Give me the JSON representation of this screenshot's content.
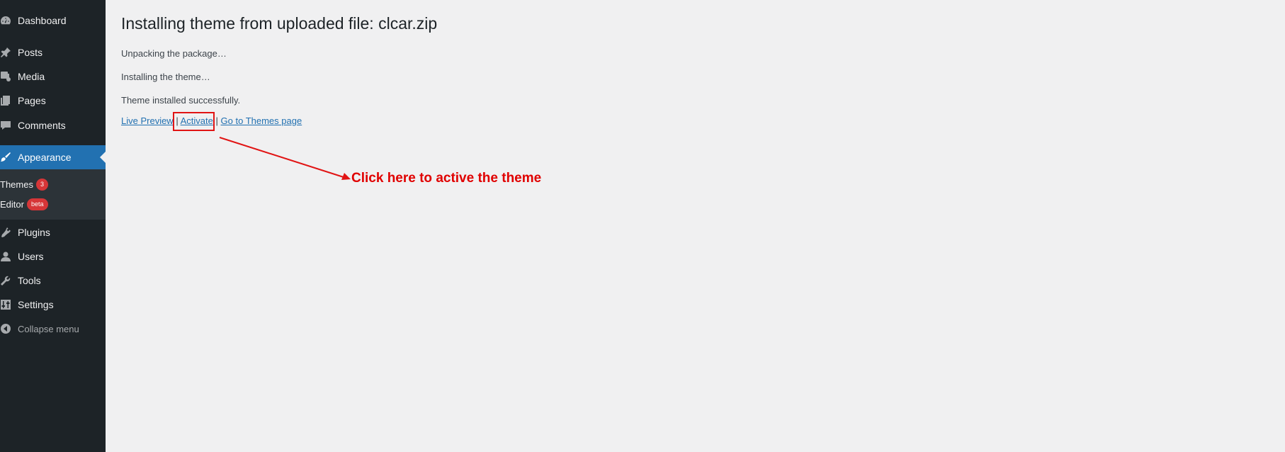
{
  "sidebar": {
    "items": [
      {
        "label": "Dashboard",
        "icon": "dashboard-icon"
      },
      {
        "label": "Posts",
        "icon": "pin-icon"
      },
      {
        "label": "Media",
        "icon": "media-icon"
      },
      {
        "label": "Pages",
        "icon": "pages-icon"
      },
      {
        "label": "Comments",
        "icon": "comment-icon"
      },
      {
        "label": "Appearance",
        "icon": "brush-icon",
        "current": true
      },
      {
        "label": "Plugins",
        "icon": "plugin-icon"
      },
      {
        "label": "Users",
        "icon": "user-icon"
      },
      {
        "label": "Tools",
        "icon": "wrench-icon"
      },
      {
        "label": "Settings",
        "icon": "settings-icon"
      },
      {
        "label": "Collapse menu",
        "icon": "collapse-icon"
      }
    ],
    "submenu": [
      {
        "label": "Themes",
        "badge": "3"
      },
      {
        "label": "Editor",
        "badge": "beta"
      }
    ]
  },
  "main": {
    "title": "Installing theme from uploaded file: clcar.zip",
    "messages": [
      "Unpacking the package…",
      "Installing the theme…",
      "Theme installed successfully."
    ],
    "actions": {
      "live_preview": "Live Preview",
      "activate": "Activate",
      "themes_page": "Go to Themes page",
      "separator": "|"
    }
  },
  "annotation": {
    "text": "Click here to active the theme",
    "color": "#e00000"
  },
  "colors": {
    "sidebar_bg": "#1d2327",
    "submenu_bg": "#2c3338",
    "accent": "#2271b1",
    "badge": "#d63638",
    "content_bg": "#f0f0f1"
  }
}
